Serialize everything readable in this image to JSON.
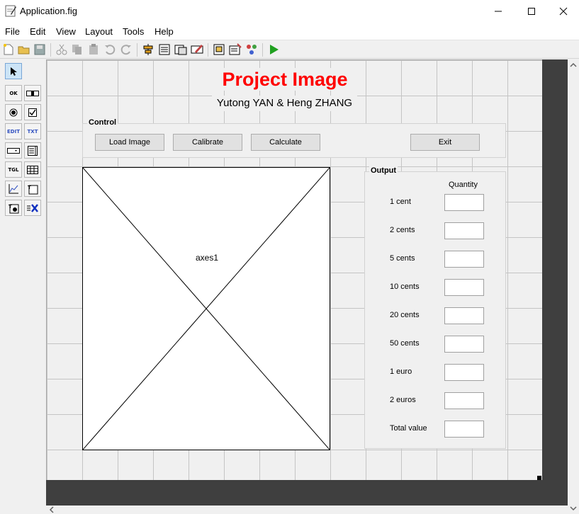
{
  "window": {
    "title": "Application.fig"
  },
  "menu": [
    "File",
    "Edit",
    "View",
    "Layout",
    "Tools",
    "Help"
  ],
  "figure": {
    "title": "Project Image",
    "title_color": "#ff0000",
    "authors": "Yutong YAN & Heng ZHANG"
  },
  "control": {
    "title": "Control",
    "buttons": {
      "load": "Load Image",
      "calibrate": "Calibrate",
      "calculate": "Calculate",
      "exit": "Exit"
    }
  },
  "axes": {
    "label": "axes1"
  },
  "output": {
    "title": "Output",
    "header": "Quantity",
    "rows": [
      "1 cent",
      "2 cents",
      "5 cents",
      "10 cents",
      "20 cents",
      "50 cents",
      "1 euro",
      "2 euros",
      "Total value"
    ]
  },
  "palette_labels": {
    "pushbutton": "OK",
    "edit": "EDIT",
    "text": "TXT",
    "toggle": "TGL"
  }
}
